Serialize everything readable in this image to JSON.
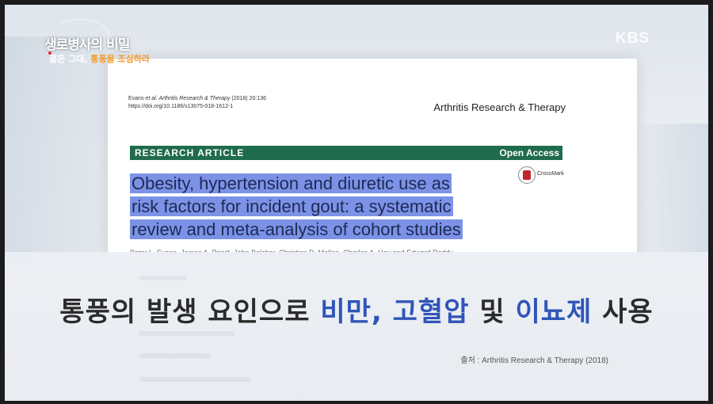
{
  "program": {
    "title": "생로병사의 비밀",
    "subtitle_prefix": "젊은 그대,",
    "subtitle_highlight": "통풍을 조심하라",
    "channel_logo": "KBS"
  },
  "paper": {
    "citation_line1_author": "Evans",
    "citation_line1_etal": "et al.",
    "citation_line1_journal": "Arthritis Research & Therapy",
    "citation_line1_rest": "(2018) 20:136",
    "citation_line2": "https://doi.org/10.1186/s13075-018-1612-1",
    "journal": "Arthritis Research & Therapy",
    "banner_left": "RESEARCH ARTICLE",
    "banner_right": "Open Access",
    "crossmark": "CrossMark",
    "title_lines": [
      "Obesity, hypertension and diuretic use as",
      "risk factors for incident gout: a systematic",
      "review and meta-analysis of cohort studies"
    ],
    "authors": "Peter L. Evans, James A. Prior*, John Belcher, Christian D. Mallen, Charles A. Hay and Edward Roddy"
  },
  "caption": {
    "part1": "통풍의 발생 요인으로 ",
    "hl1": "비만, 고혈압",
    "part2": " 및 ",
    "hl2": "이뇨제",
    "part3": " 사용",
    "highlight_color": "#2f55b8"
  },
  "source": "출처 : Arthritis Research & Therapy (2018)",
  "colors": {
    "banner": "#1f6b4e",
    "title_highlight": "#7b92e6",
    "subtitle_accent": "#f39a2d"
  }
}
